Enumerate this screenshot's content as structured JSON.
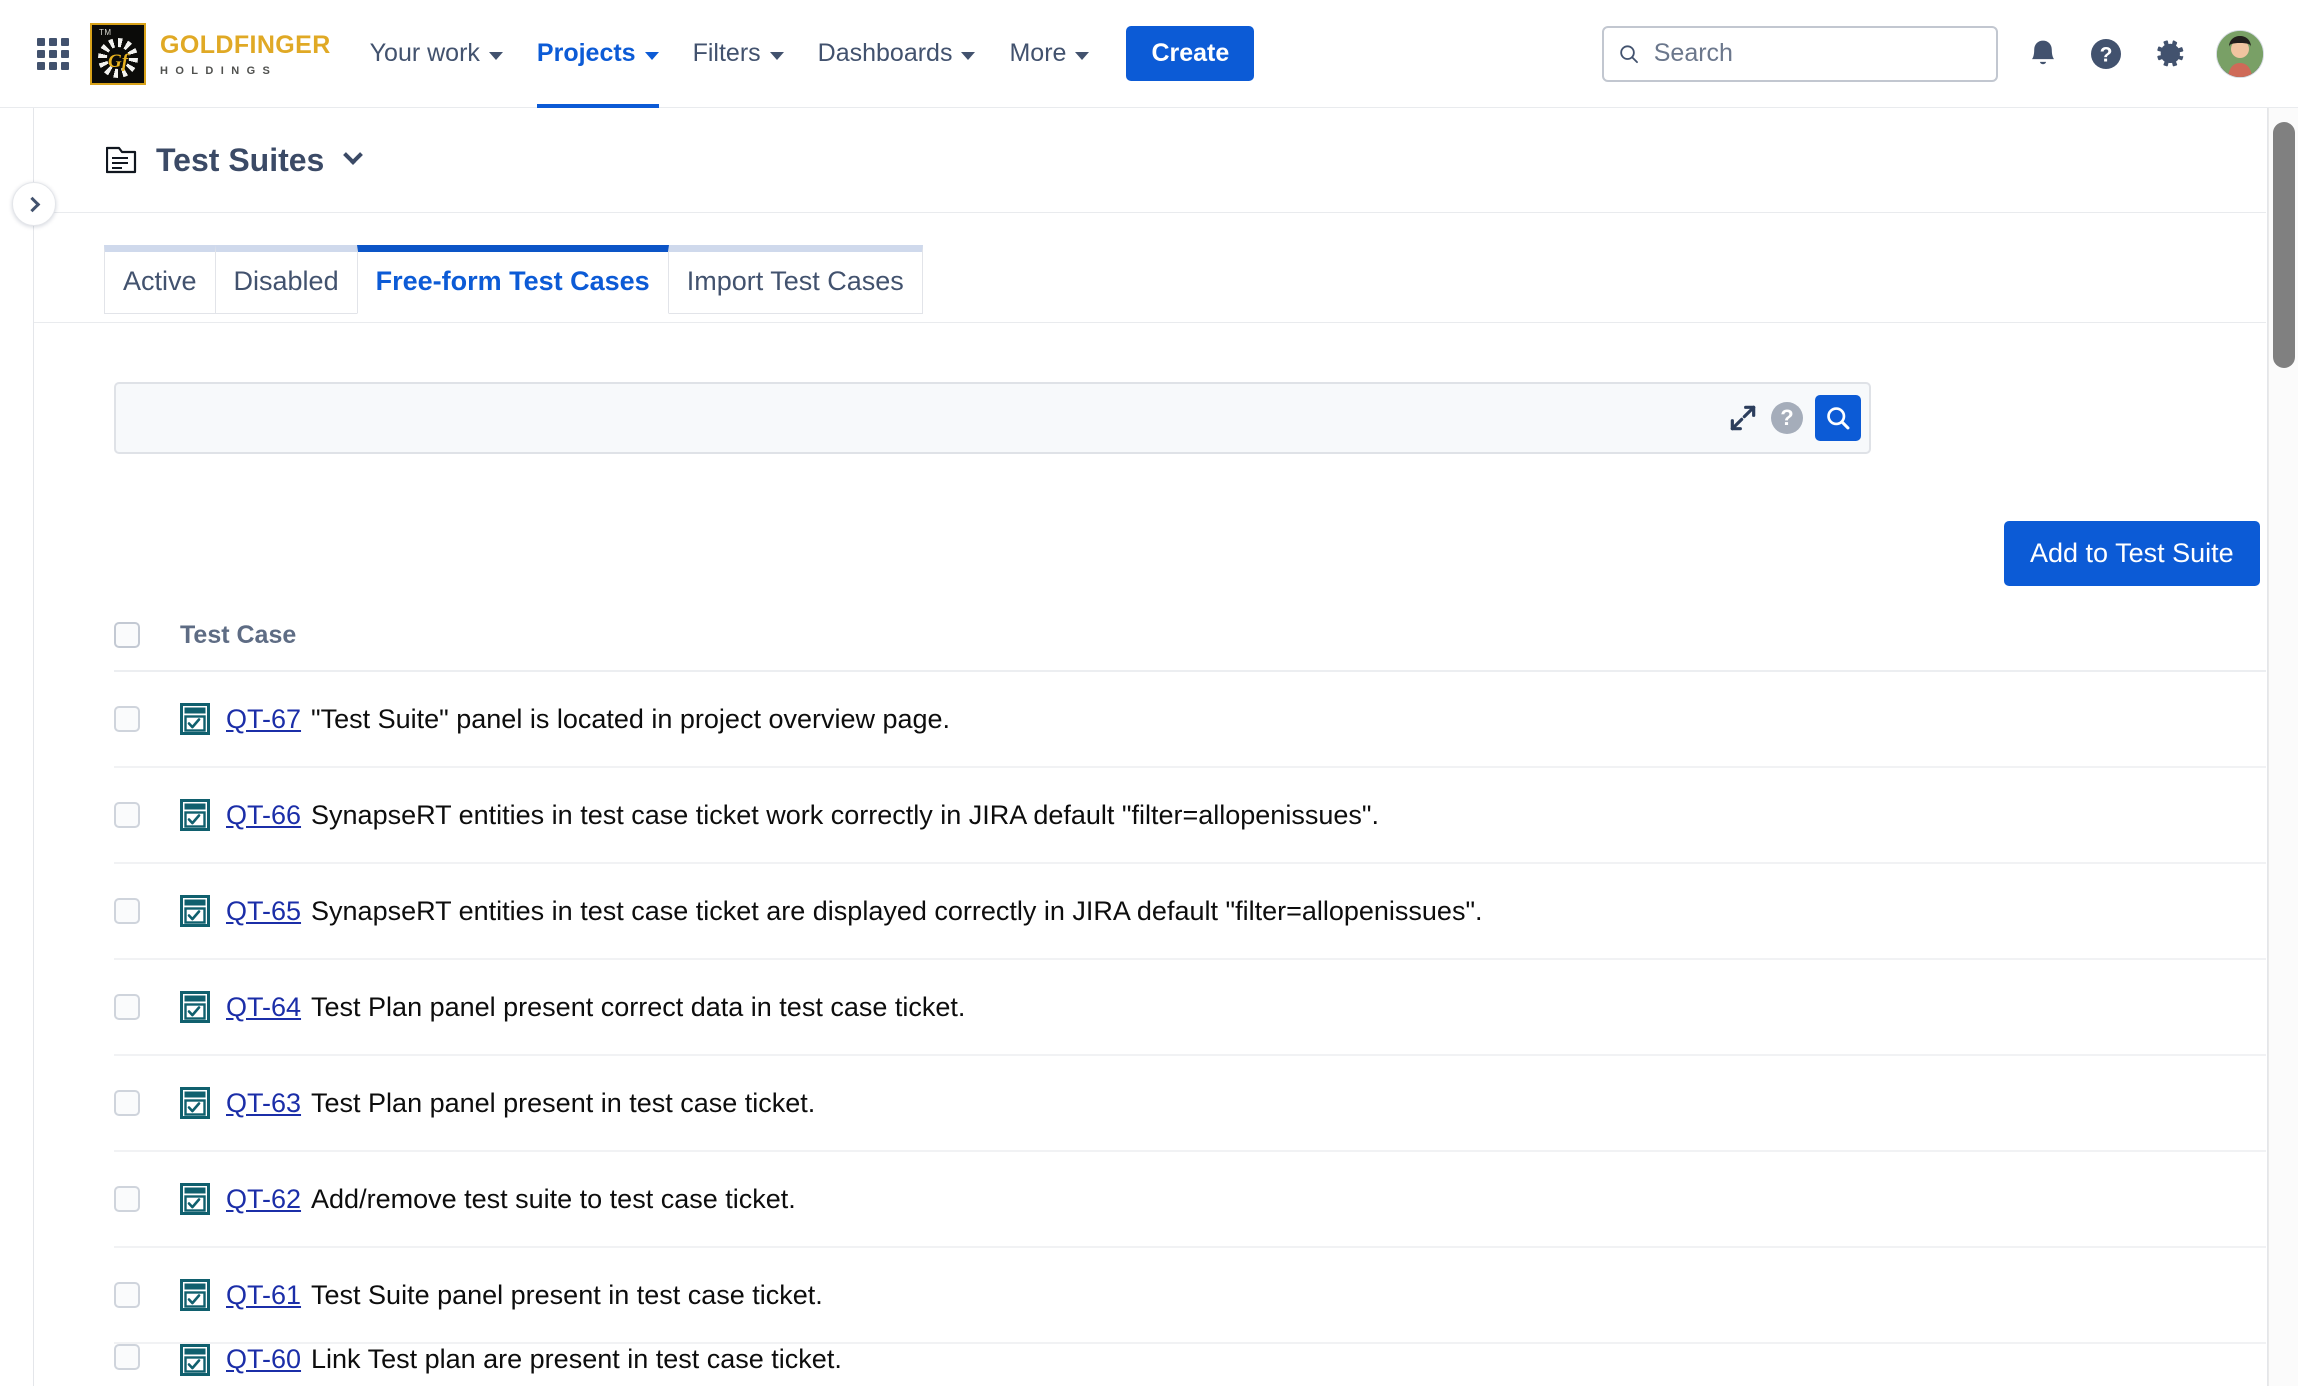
{
  "topnav": {
    "apps_icon": "apps-grid-icon",
    "brand": {
      "mark_initials": "Gf",
      "mark_tm": "TM",
      "name": "GOLDFINGER",
      "tagline": "HOLDINGS"
    },
    "items": [
      {
        "label": "Your work",
        "has_caret": true,
        "active": false
      },
      {
        "label": "Projects",
        "has_caret": true,
        "active": true
      },
      {
        "label": "Filters",
        "has_caret": true,
        "active": false
      },
      {
        "label": "Dashboards",
        "has_caret": true,
        "active": false
      },
      {
        "label": "More",
        "has_caret": true,
        "active": false
      }
    ],
    "create_label": "Create",
    "search": {
      "value": "",
      "placeholder": "Search"
    },
    "icons": [
      "notifications-icon",
      "help-icon",
      "settings-icon",
      "avatar"
    ]
  },
  "sidebar": {
    "toggle_icon": "chevron-right-icon"
  },
  "header": {
    "icon": "test-suites-folder-icon",
    "title": "Test Suites",
    "dropdown_icon": "chevron-down-icon"
  },
  "tabs": [
    {
      "label": "Active",
      "active": false
    },
    {
      "label": "Disabled",
      "active": false
    },
    {
      "label": "Free-form Test Cases",
      "active": true
    },
    {
      "label": "Import Test Cases",
      "active": false
    }
  ],
  "query": {
    "value": "",
    "placeholder": "",
    "expand_icon": "expand-icon",
    "help_icon": "help-circle-icon",
    "search_icon": "search-icon"
  },
  "actions": {
    "add_to_test_suite": "Add to Test Suite"
  },
  "table": {
    "select_all": "select-all-checkbox",
    "columns": [
      "Test Case"
    ],
    "rows": [
      {
        "key": "QT-67",
        "summary": "\"Test Suite\" panel is located in project overview page."
      },
      {
        "key": "QT-66",
        "summary": "SynapseRT entities in test case ticket work correctly in JIRA default \"filter=allopenissues\"."
      },
      {
        "key": "QT-65",
        "summary": "SynapseRT entities in test case ticket are displayed correctly in JIRA default \"filter=allopenissues\"."
      },
      {
        "key": "QT-64",
        "summary": "Test Plan panel present correct data in test case ticket."
      },
      {
        "key": "QT-63",
        "summary": "Test Plan panel present in test case ticket."
      },
      {
        "key": "QT-62",
        "summary": "Add/remove test suite to test case ticket."
      },
      {
        "key": "QT-61",
        "summary": "Test Suite panel present in test case ticket."
      },
      {
        "key": "QT-60",
        "summary": "Link Test plan are present in test case ticket."
      }
    ]
  },
  "scrollbar": {
    "name": "vertical-scrollbar"
  },
  "colors": {
    "brand_gold": "#e0a925",
    "accent_blue": "#0c5bd6",
    "link_blue": "#1b2ea8",
    "text_dark": "#172b4d",
    "icon_teal": "#10606e"
  }
}
